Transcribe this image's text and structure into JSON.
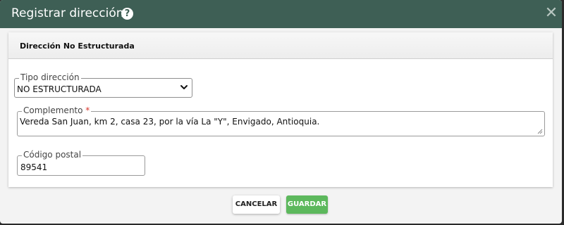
{
  "dialog": {
    "title": "Registrar dirección",
    "help_icon": "question-circle-icon",
    "help_glyph": "?",
    "close_icon": "close-icon",
    "close_glyph": "✕",
    "header_color": "#3e5f55"
  },
  "section": {
    "title": "Dirección No Estructurada"
  },
  "fields": {
    "tipo_direccion": {
      "label": "Tipo dirección",
      "value": "NO ESTRUCTURADA"
    },
    "complemento": {
      "label": "Complemento",
      "required_mark": "*",
      "value": "Vereda San Juan, km 2, casa 23, por la vía La \"Y\", Envigado, Antioquia."
    },
    "codigo_postal": {
      "label": "Código postal",
      "value": "89541"
    }
  },
  "buttons": {
    "cancel_label": "CANCELAR",
    "save_label": "GUARDAR",
    "save_color": "#5cb85c"
  }
}
